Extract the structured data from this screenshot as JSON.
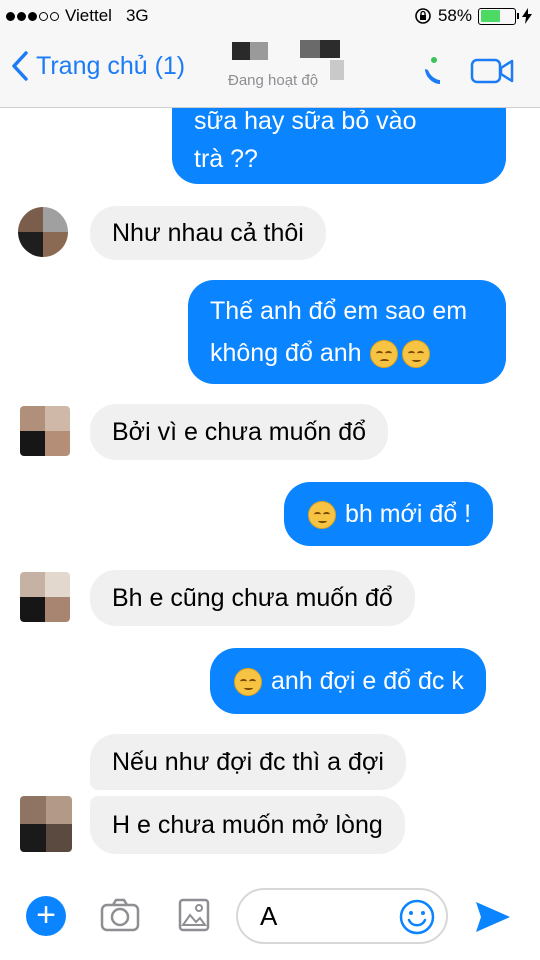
{
  "status_bar": {
    "carrier": "Viettel",
    "network": "3G",
    "battery": "58%",
    "battery_level": 0.58
  },
  "header": {
    "back_label": "Trang chủ (1)",
    "subtitle": "Đang hoạt độ",
    "icons": [
      "chevron-left-icon",
      "phone-call-icon",
      "video-camera-icon"
    ],
    "accent_color": "#1b7cf5"
  },
  "messages": [
    {
      "side": "out",
      "lines": [
        "sữa hay sữa bỏ vào",
        "trà ??"
      ]
    },
    {
      "side": "in",
      "text": "Như nhau cả thôi"
    },
    {
      "side": "out",
      "lines": [
        "Thế anh đổ em sao em",
        "không đổ anh"
      ],
      "emoji": [
        "sad-face",
        "pensive-face"
      ]
    },
    {
      "side": "in",
      "text": "Bởi vì e chưa muốn đổ"
    },
    {
      "side": "out",
      "text": "bh mới đổ !",
      "emoji": [
        "pensive-face"
      ]
    },
    {
      "side": "in",
      "text": "Bh e cũng chưa muốn đổ"
    },
    {
      "side": "out",
      "text": "anh đợi e đổ đc k",
      "emoji": [
        "pensive-face"
      ]
    },
    {
      "side": "in",
      "text": "Nếu như đợi đc thì a đợi"
    },
    {
      "side": "in",
      "text": "H e chưa muốn mở lòng"
    }
  ],
  "composer": {
    "value": "A",
    "icons": [
      "plus-icon",
      "camera-icon",
      "photo-icon",
      "smiley-icon",
      "send-icon"
    ]
  },
  "colors": {
    "outgoing_bubble": "#0a84ff",
    "incoming_bubble": "#f0f0f0"
  }
}
